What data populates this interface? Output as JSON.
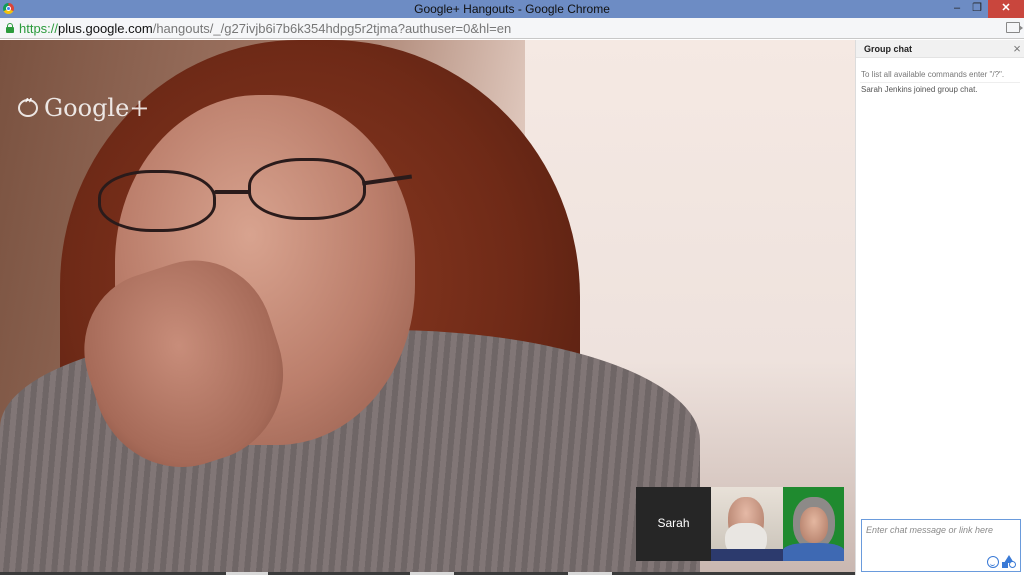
{
  "window": {
    "title": "Google+ Hangouts - Google Chrome",
    "controls": {
      "minimize": "‒",
      "restore": "❐",
      "close": "✕"
    }
  },
  "addressbar": {
    "scheme": "https://",
    "host": "plus.google.com",
    "path": "/hangouts/_/g27ivjb6i7b6k354hdpg5r2tjma?authuser=0&hl=en",
    "icons": [
      "lock-icon",
      "camera-icon"
    ],
    "colors": {
      "secure": "#2c9b3c"
    }
  },
  "video": {
    "watermark": "Google+"
  },
  "filmstrip": {
    "participants": [
      {
        "name": "Sarah"
      }
    ]
  },
  "chat": {
    "title": "Group chat",
    "close": "×",
    "messages": [
      "To list all available commands enter \"/?\".",
      "Sarah Jenkins joined group chat."
    ],
    "input_placeholder": "Enter chat message or link here",
    "icons": [
      "smiley-icon",
      "shapes-icon"
    ],
    "colors": {
      "input_border": "#6a9bdc",
      "accent": "#3a7ad6"
    }
  }
}
